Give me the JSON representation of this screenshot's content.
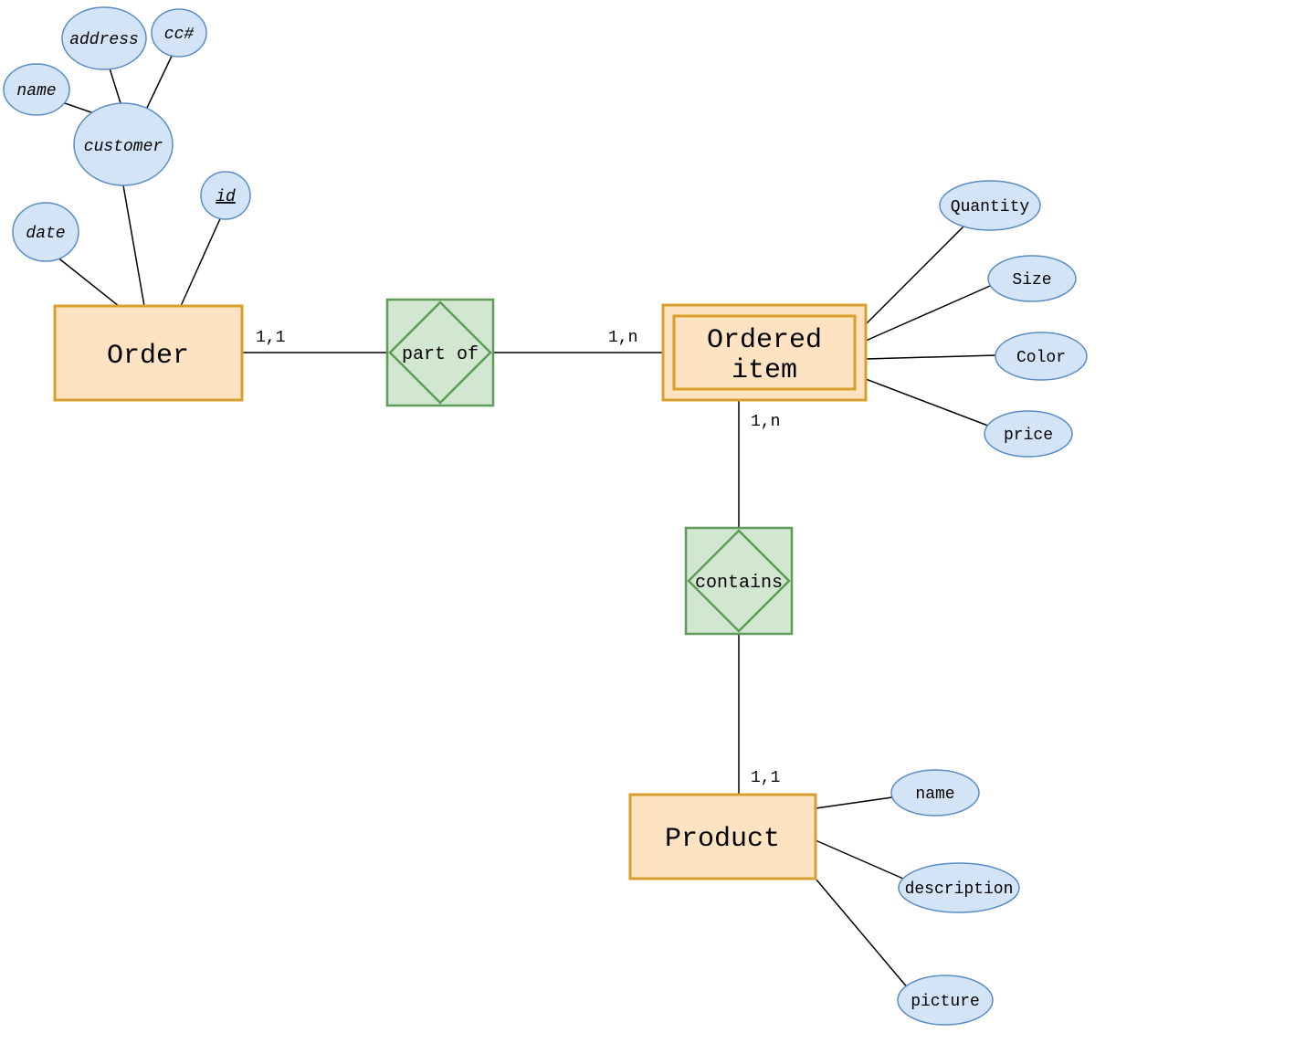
{
  "entities": {
    "order": "Order",
    "ordered_item_l1": "Ordered",
    "ordered_item_l2": "item",
    "product": "Product"
  },
  "relationships": {
    "part_of": "part of",
    "contains": "contains"
  },
  "attributes": {
    "order": {
      "date": "date",
      "customer": "customer",
      "id": "id",
      "name": "name",
      "address": "address",
      "cc": "cc#"
    },
    "ordered_item": {
      "quantity": "Quantity",
      "size": "Size",
      "color": "Color",
      "price": "price"
    },
    "product": {
      "name": "name",
      "description": "description",
      "picture": "picture"
    }
  },
  "cardinalities": {
    "order_partof": "1,1",
    "partof_ordered": "1,n",
    "ordered_contains": "1,n",
    "contains_product": "1,1"
  }
}
